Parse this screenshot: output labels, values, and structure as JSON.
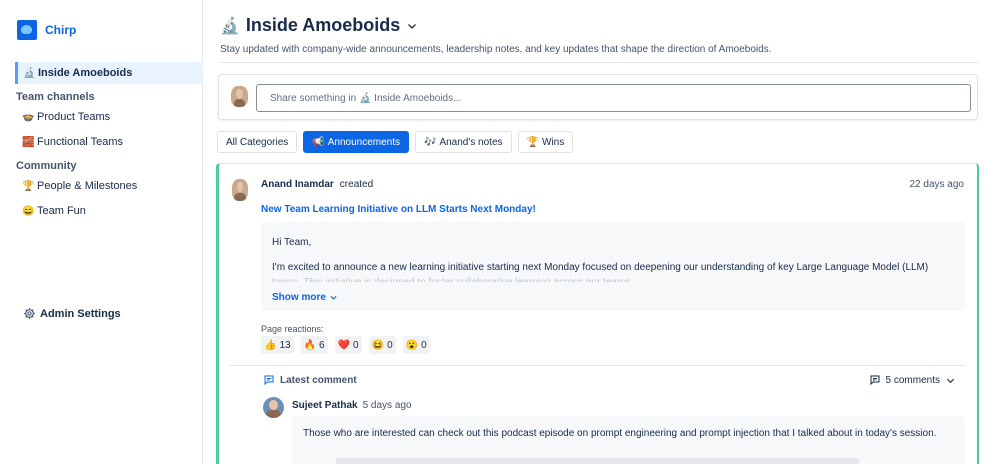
{
  "brand": {
    "name": "Chirp"
  },
  "sidebar": {
    "active": {
      "emoji": "🔬",
      "label": "Inside Amoeboids"
    },
    "groups": [
      {
        "label": "Team channels"
      },
      {
        "label": "Community"
      }
    ],
    "items": [
      {
        "emoji": "🍲",
        "label": "Product Teams"
      },
      {
        "emoji": "🧱",
        "label": "Functional Teams"
      },
      {
        "emoji": "🏆",
        "label": "People & Milestones"
      },
      {
        "emoji": "😄",
        "label": "Team Fun"
      }
    ],
    "admin": {
      "label": "Admin Settings",
      "icon": "gear-icon"
    }
  },
  "header": {
    "emoji": "🔬",
    "title": "Inside Amoeboids",
    "subtitle": "Stay updated with company-wide announcements, leadership notes, and key updates that shape the direction of Amoeboids."
  },
  "composer": {
    "placeholder": "Share something in 🔬 Inside Amoeboids..."
  },
  "categories": [
    {
      "emoji": "",
      "label": "All Categories",
      "active": false
    },
    {
      "emoji": "📢",
      "label": "Announcements",
      "active": true
    },
    {
      "emoji": "🎶",
      "label": "Anand's notes",
      "active": false
    },
    {
      "emoji": "🏆",
      "label": "Wins",
      "active": false
    }
  ],
  "post": {
    "author": "Anand Inamdar",
    "action": "created",
    "time": "22 days ago",
    "title": "New Team Learning Initiative on LLM Starts Next Monday!",
    "greeting": "Hi Team,",
    "body": "I'm excited to announce a new learning initiative starting next Monday focused on deepening our understanding of key Large Language Model (LLM)",
    "body_cont": "topics. This initiative is designed to foster collaborative learning across our teams.",
    "show_more": "Show more",
    "reactions_label": "Page reactions:",
    "reactions": [
      {
        "emoji": "👍",
        "count": "13"
      },
      {
        "emoji": "🔥",
        "count": "6"
      },
      {
        "emoji": "❤️",
        "count": "0"
      },
      {
        "emoji": "😆",
        "count": "0"
      },
      {
        "emoji": "😮",
        "count": "0"
      }
    ],
    "latest_comment_label": "Latest comment",
    "comments_count": "5 comments",
    "comment": {
      "author": "Sujeet Pathak",
      "time": "5 days ago",
      "text": "Those who are interested can check out this podcast episode on prompt engineering and prompt injection that I talked about in today's session."
    }
  },
  "colors": {
    "accent": "#0c66e4",
    "card_border": "#4bce97",
    "active_nav": "#e9f2ff"
  }
}
